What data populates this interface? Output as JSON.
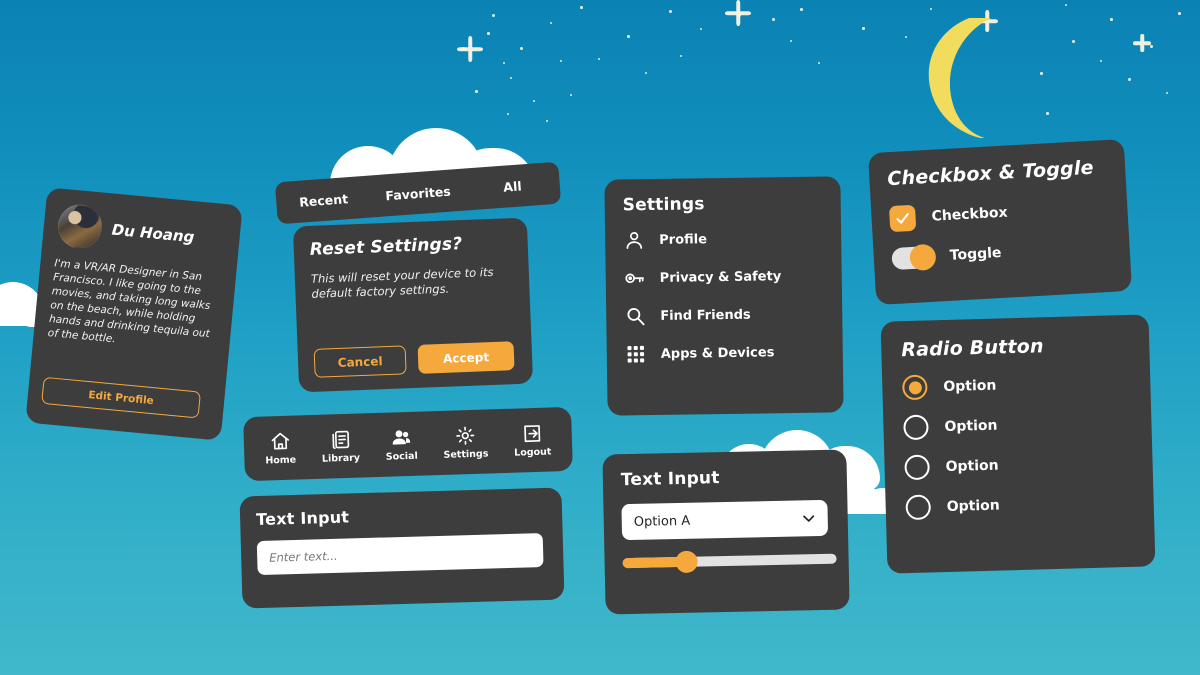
{
  "background": {
    "sky_top_color": "#0b82b4",
    "sky_bottom_color": "#41b8cb",
    "moon_color": "#f2dc5d",
    "star_color": "#fdf6e3",
    "cloud_color": "#ffffff"
  },
  "theme": {
    "panel_color": "#3d3d3d",
    "accent_color": "#f5a83c",
    "text_color": "#ffffff",
    "field_color": "#ffffff"
  },
  "profile": {
    "name": "Du Hoang",
    "bio": "I'm a VR/AR Designer in San Francisco. I like going to the movies, and taking long walks on the beach, while holding hands and drinking tequila out of the bottle.",
    "edit_button": "Edit Profile",
    "avatar_alt": "avatar"
  },
  "tabs": [
    {
      "label": "Recent"
    },
    {
      "label": "Favorites"
    },
    {
      "label": "All"
    }
  ],
  "reset_dialog": {
    "title": "Reset Settings?",
    "body": "This will reset your device to its default factory settings.",
    "cancel_label": "Cancel",
    "accept_label": "Accept"
  },
  "nav": [
    {
      "label": "Home",
      "icon": "home-icon"
    },
    {
      "label": "Library",
      "icon": "library-icon"
    },
    {
      "label": "Social",
      "icon": "social-icon"
    },
    {
      "label": "Settings",
      "icon": "gear-icon"
    },
    {
      "label": "Logout",
      "icon": "logout-icon"
    }
  ],
  "text_input_left": {
    "title": "Text Input",
    "value": "",
    "placeholder": "Enter text..."
  },
  "settings": {
    "title": "Settings",
    "items": [
      {
        "label": "Profile",
        "icon": "person-icon"
      },
      {
        "label": "Privacy & Safety",
        "icon": "key-icon"
      },
      {
        "label": "Find Friends",
        "icon": "search-icon"
      },
      {
        "label": "Apps & Devices",
        "icon": "grid-icon"
      }
    ]
  },
  "text_input_center": {
    "title": "Text Input",
    "selected_option": "Option A",
    "options": [
      "Option A"
    ],
    "slider_percent": 30
  },
  "checkbox_panel": {
    "title": "Checkbox & Toggle",
    "checkbox_label": "Checkbox",
    "checkbox_checked": true,
    "toggle_label": "Toggle",
    "toggle_on": true
  },
  "radio_panel": {
    "title": "Radio Button",
    "options": [
      {
        "label": "Option",
        "selected": true
      },
      {
        "label": "Option",
        "selected": false
      },
      {
        "label": "Option",
        "selected": false
      },
      {
        "label": "Option",
        "selected": false
      }
    ]
  }
}
